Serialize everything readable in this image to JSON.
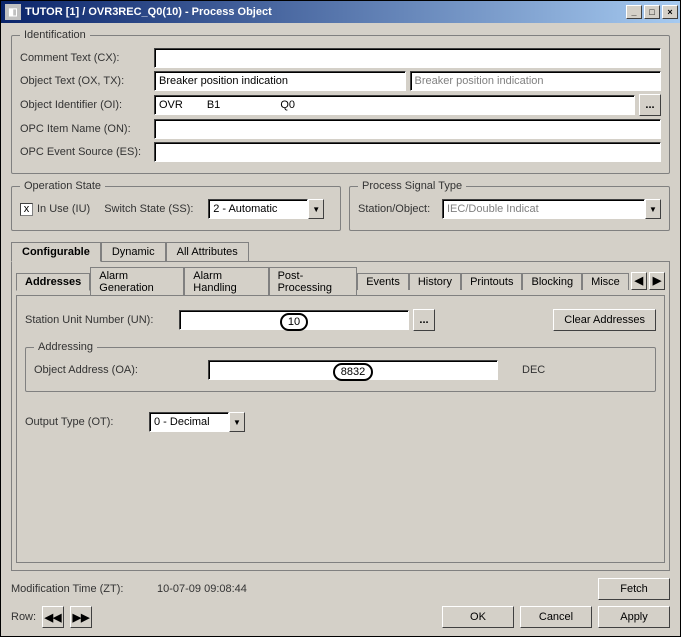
{
  "window": {
    "title": "TUTOR [1] / OVR3REC_Q0(10) - Process Object"
  },
  "identification": {
    "legend": "Identification",
    "comment_text_label": "Comment Text (CX):",
    "comment_text_value": "",
    "object_text_label": "Object Text (OX, TX):",
    "object_text_value": "Breaker position indication",
    "object_text_placeholder": "Breaker position indication",
    "object_identifier_label": "Object Identifier (OI):",
    "oi_part1": "OVR",
    "oi_part2": "B1",
    "oi_part3": "Q0",
    "browse_label": "...",
    "opc_item_name_label": "OPC Item Name (ON):",
    "opc_item_name_value": "",
    "opc_event_source_label": "OPC Event Source (ES):",
    "opc_event_source_value": ""
  },
  "operation_state": {
    "legend": "Operation State",
    "in_use_label": "In Use (IU)",
    "in_use_checked": "x",
    "switch_state_label": "Switch State (SS):",
    "switch_state_value": "2 - Automatic"
  },
  "process_signal": {
    "legend": "Process Signal Type",
    "station_object_label": "Station/Object:",
    "station_object_value": "IEC/Double Indicat"
  },
  "tabs_primary": {
    "configurable": "Configurable",
    "dynamic": "Dynamic",
    "all_attributes": "All Attributes"
  },
  "tabs_secondary": {
    "addresses": "Addresses",
    "alarm_generation": "Alarm Generation",
    "alarm_handling": "Alarm Handling",
    "post_processing": "Post-Processing",
    "events": "Events",
    "history": "History",
    "printouts": "Printouts",
    "blocking": "Blocking",
    "misc": "Misce"
  },
  "addresses": {
    "station_unit_label": "Station Unit Number (UN):",
    "station_unit_value": "10",
    "browse_label": "...",
    "clear_button": "Clear Addresses",
    "addressing_legend": "Addressing",
    "object_address_label": "Object Address (OA):",
    "object_address_value": "8832",
    "object_address_unit": "DEC",
    "output_type_label": "Output Type (OT):",
    "output_type_value": "0 - Decimal"
  },
  "footer": {
    "mod_time_label": "Modification Time (ZT):",
    "mod_time_value": "10-07-09 09:08:44",
    "fetch": "Fetch",
    "row_label": "Row:",
    "prev": "⏮",
    "next": "⏭",
    "ok": "OK",
    "cancel": "Cancel",
    "apply": "Apply"
  }
}
